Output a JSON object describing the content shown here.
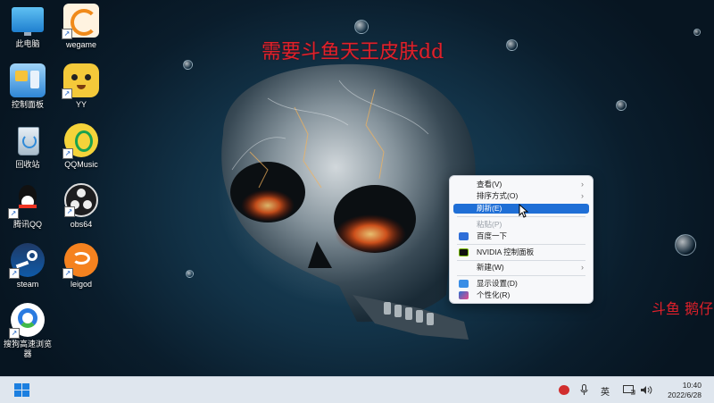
{
  "watermark": {
    "main": "需要斗鱼天王皮肤dd",
    "side": "斗鱼 鹅仔"
  },
  "desktop_icons": [
    {
      "label": "此电脑",
      "icon": "computer-icon",
      "shortcut": false
    },
    {
      "label": "wegame",
      "icon": "wegame-icon",
      "shortcut": true
    },
    {
      "label": "控制面板",
      "icon": "control-panel-icon",
      "shortcut": false
    },
    {
      "label": "YY",
      "icon": "yy-icon",
      "shortcut": true
    },
    {
      "label": "回收站",
      "icon": "recycle-bin-icon",
      "shortcut": false
    },
    {
      "label": "QQMusic",
      "icon": "qqmusic-icon",
      "shortcut": true
    },
    {
      "label": "腾讯QQ",
      "icon": "qq-icon",
      "shortcut": true
    },
    {
      "label": "obs64",
      "icon": "obs-icon",
      "shortcut": true
    },
    {
      "label": "steam",
      "icon": "steam-icon",
      "shortcut": true
    },
    {
      "label": "leigod",
      "icon": "leigod-icon",
      "shortcut": true
    },
    {
      "label": "搜狗高速浏览器",
      "icon": "sogou-browser-icon",
      "shortcut": true
    }
  ],
  "context_menu": {
    "items": [
      {
        "label": "查看(V)",
        "submenu": true
      },
      {
        "label": "排序方式(O)",
        "submenu": true
      },
      {
        "label": "刷新(E)",
        "highlighted": true
      },
      {
        "label": "粘贴(P)",
        "disabled": true
      },
      {
        "label": "百度一下",
        "icon": "baidu-icon"
      },
      {
        "label": "NVIDIA 控制面板",
        "icon": "nvidia-icon"
      },
      {
        "label": "新建(W)",
        "submenu": true
      },
      {
        "label": "显示设置(D)",
        "icon": "display-settings-icon"
      },
      {
        "label": "个性化(R)",
        "icon": "personalize-icon"
      }
    ],
    "submenu_arrow": "›"
  },
  "taskbar": {
    "ime": "英",
    "clock_time": "10:40",
    "clock_date": "2022/6/28"
  },
  "colors": {
    "accent": "#1f6fd6",
    "watermark": "#e0202a",
    "taskbar": "#dfe6ee"
  }
}
